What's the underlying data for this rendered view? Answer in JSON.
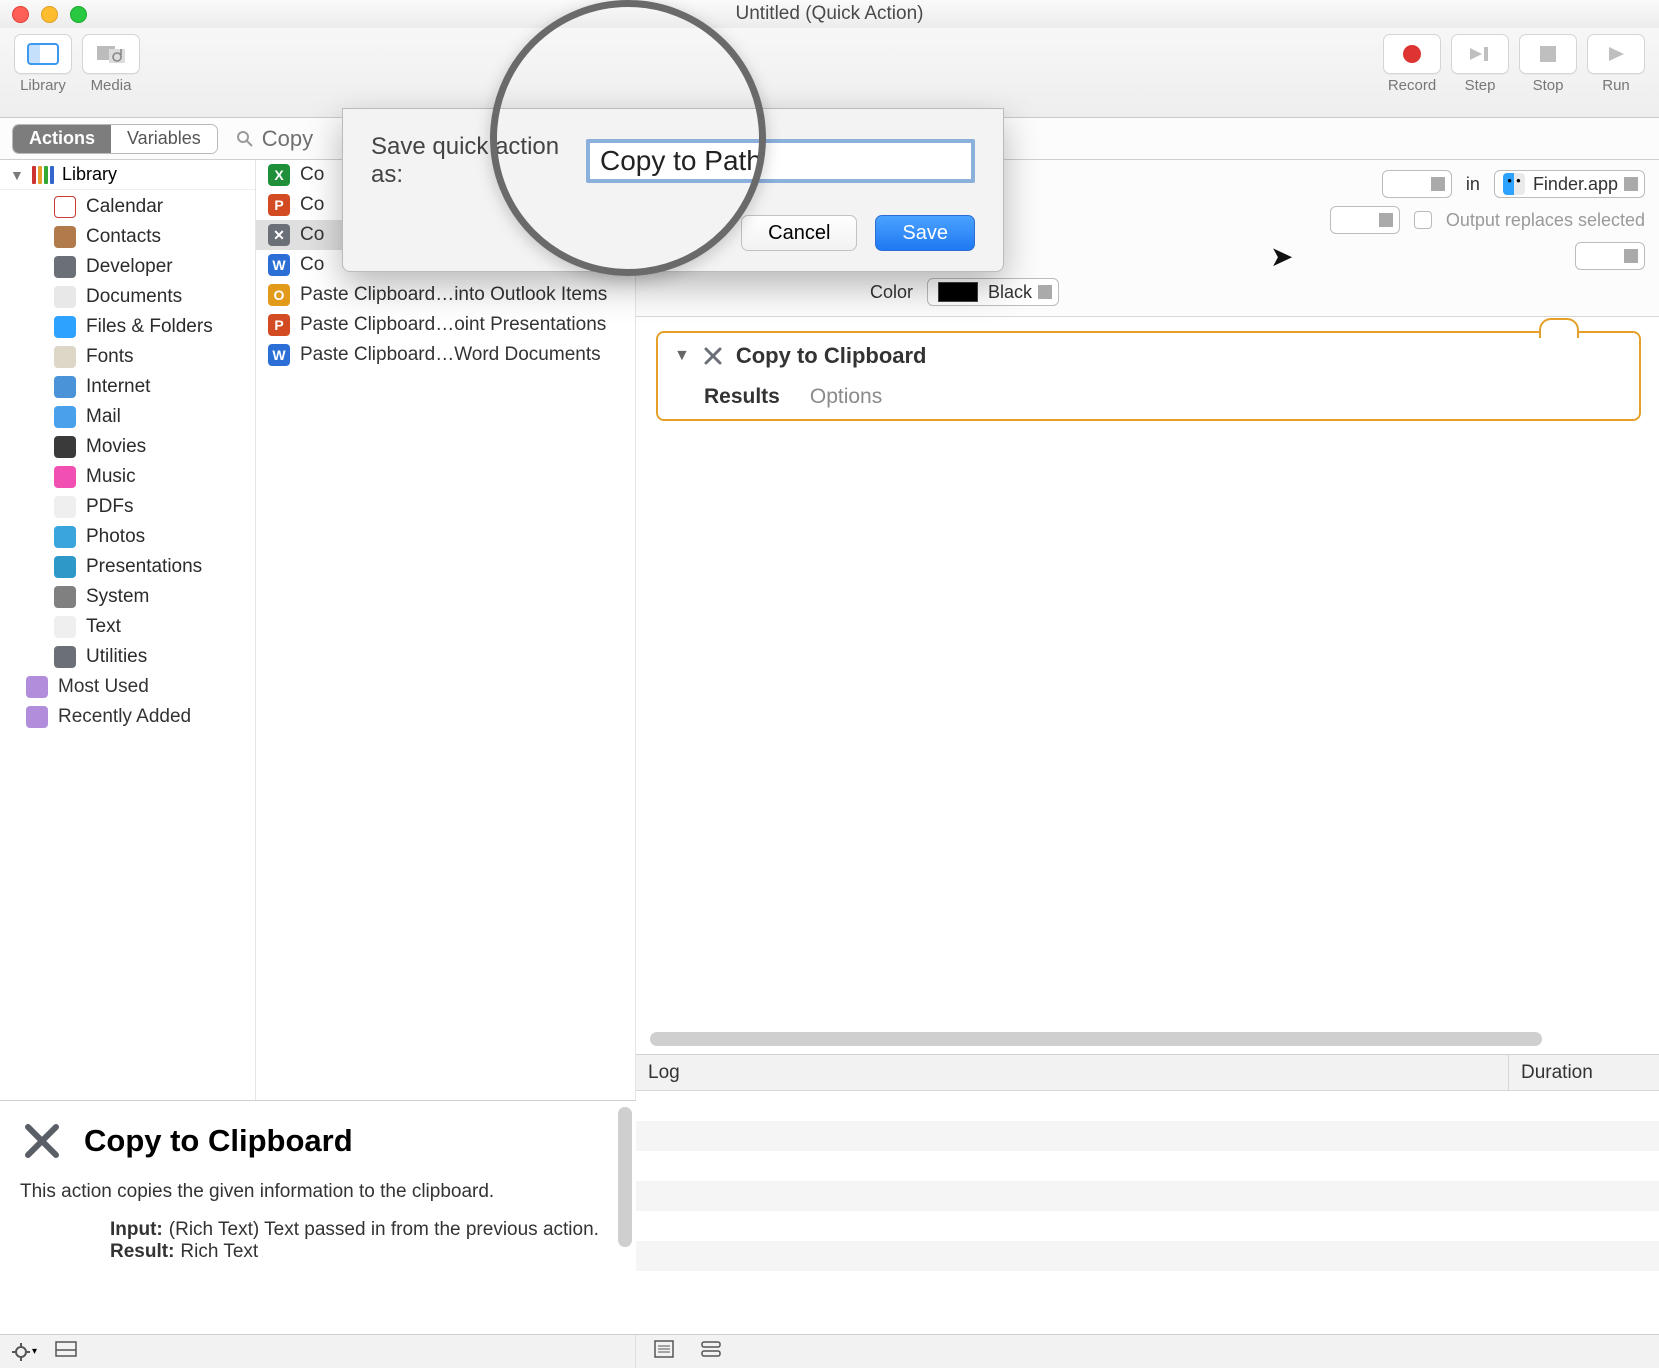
{
  "title": "Untitled (Quick Action)",
  "toolbar": {
    "library": "Library",
    "media": "Media",
    "record": "Record",
    "step": "Step",
    "stop": "Stop",
    "run": "Run"
  },
  "segmented": {
    "actions": "Actions",
    "variables": "Variables"
  },
  "search": {
    "placeholder": "Copy"
  },
  "library": {
    "root": "Library",
    "items": [
      {
        "label": "Calendar",
        "icon_bg": "#ffffff",
        "icon_border": "#cc3b3b"
      },
      {
        "label": "Contacts",
        "icon_bg": "#b07a4a"
      },
      {
        "label": "Developer",
        "icon_bg": "#6b6f77"
      },
      {
        "label": "Documents",
        "icon_bg": "#e8e8e8"
      },
      {
        "label": "Files & Folders",
        "icon_bg": "#2ea2ff"
      },
      {
        "label": "Fonts",
        "icon_bg": "#ded6c6"
      },
      {
        "label": "Internet",
        "icon_bg": "#4a93d8"
      },
      {
        "label": "Mail",
        "icon_bg": "#4aa0ea"
      },
      {
        "label": "Movies",
        "icon_bg": "#3a3a3a"
      },
      {
        "label": "Music",
        "icon_bg": "#f14fb2"
      },
      {
        "label": "PDFs",
        "icon_bg": "#efefef"
      },
      {
        "label": "Photos",
        "icon_bg": "#3aa4dc"
      },
      {
        "label": "Presentations",
        "icon_bg": "#2e99c9"
      },
      {
        "label": "System",
        "icon_bg": "#808080"
      },
      {
        "label": "Text",
        "icon_bg": "#efefef"
      },
      {
        "label": "Utilities",
        "icon_bg": "#6b6f77"
      }
    ],
    "smart": [
      {
        "label": "Most Used"
      },
      {
        "label": "Recently Added"
      }
    ]
  },
  "actions": {
    "items": [
      {
        "label": "Co",
        "chip": "X",
        "color": "#1f8f3a"
      },
      {
        "label": "Co",
        "chip": "P",
        "color": "#d34b22"
      },
      {
        "label": "Co",
        "chip": "✕",
        "color": "#6b6f77",
        "selected": true
      },
      {
        "label": "Co",
        "chip": "W",
        "color": "#2b6fd6"
      },
      {
        "label": "Paste Clipboard…into Outlook Items",
        "chip": "O",
        "color": "#e29a1b"
      },
      {
        "label": "Paste Clipboard…oint Presentations",
        "chip": "P",
        "color": "#d34b22"
      },
      {
        "label": "Paste Clipboard…Word Documents",
        "chip": "W",
        "color": "#2b6fd6"
      }
    ]
  },
  "desc": {
    "title": "Copy to Clipboard",
    "text": "This action copies the given information to the clipboard.",
    "input_label": "Input:",
    "input_value": "(Rich Text) Text passed in from the previous action.",
    "result_label": "Result:",
    "result_value": "Rich Text"
  },
  "sheet": {
    "label": "Save quick action as:",
    "value": "Copy to Path",
    "cancel": "Cancel",
    "save": "Save"
  },
  "wf": {
    "in": "in",
    "app": "Finder.app",
    "output_replaces": "Output replaces selected",
    "color_label": "Color",
    "color_value": "Black",
    "card_title": "Copy to Clipboard",
    "tab_results": "Results",
    "tab_options": "Options"
  },
  "log": {
    "log": "Log",
    "duration": "Duration"
  }
}
